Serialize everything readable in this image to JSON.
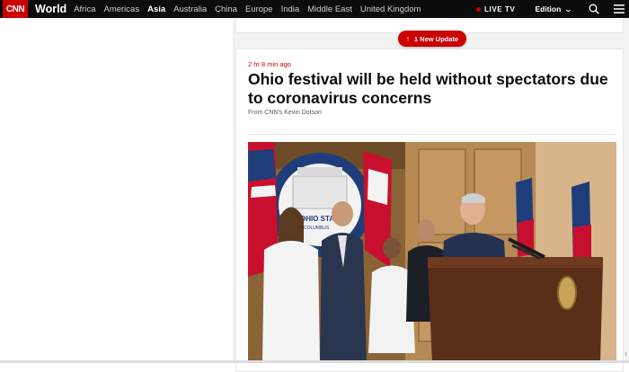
{
  "header": {
    "logo_text": "CNN",
    "section_title": "World",
    "nav_items": [
      {
        "label": "Africa",
        "active": false
      },
      {
        "label": "Americas",
        "active": false
      },
      {
        "label": "Asia",
        "active": true
      },
      {
        "label": "Australia",
        "active": false
      },
      {
        "label": "China",
        "active": false
      },
      {
        "label": "Europe",
        "active": false
      },
      {
        "label": "India",
        "active": false
      },
      {
        "label": "Middle East",
        "active": false
      },
      {
        "label": "United Kingdom",
        "active": false
      }
    ],
    "live_tv_label": "LIVE TV",
    "edition_label": "Edition",
    "icons": [
      "chevron-down-icon",
      "search-icon",
      "menu-icon"
    ]
  },
  "live_feed": {
    "update_button_label": "1 New Update",
    "update_icon": "arrow-up-icon"
  },
  "post": {
    "timestamp": "2 hr 8 min ago",
    "headline": "Ohio festival will be held without spectators due to coronavirus concerns",
    "byline": "From CNN's Kevin Dotson",
    "photo": {
      "podium_sign_text": "OHIO STATE",
      "podium_sign_subtext": "COLUMBUS"
    }
  },
  "colors": {
    "brand_red": "#cc0000",
    "nav_bg": "#0c0c0c",
    "headline": "#0c0c0c",
    "byline": "#595959",
    "page_bg": "#f2f2f2"
  }
}
